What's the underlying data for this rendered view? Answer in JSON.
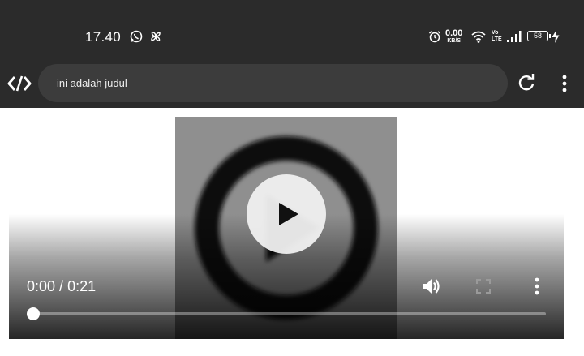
{
  "status_bar": {
    "time": "17.40",
    "net_speed_value": "0.00",
    "net_speed_unit": "KB/S",
    "volte_top": "Vo",
    "volte_bottom": "LTE",
    "battery": "58",
    "icons": [
      "whatsapp-icon",
      "pinwheel-icon",
      "alarm-icon",
      "wifi-icon",
      "signal-icon",
      "battery-icon",
      "charging-icon"
    ]
  },
  "toolbar": {
    "url_text": "ini adalah judul",
    "icons": [
      "code-logo-icon",
      "reload-icon",
      "more-vert-icon"
    ]
  },
  "video": {
    "current_time": "0:00",
    "duration": "0:21",
    "time_separator": " / ",
    "progress": 0,
    "icons": [
      "play-icon",
      "volume-icon",
      "fullscreen-icon",
      "more-vert-icon"
    ]
  },
  "colors": {
    "top_bar": "#2b2b2b",
    "url_bar": "#3c3c3c",
    "thumbnail": "#8f8f8f"
  }
}
